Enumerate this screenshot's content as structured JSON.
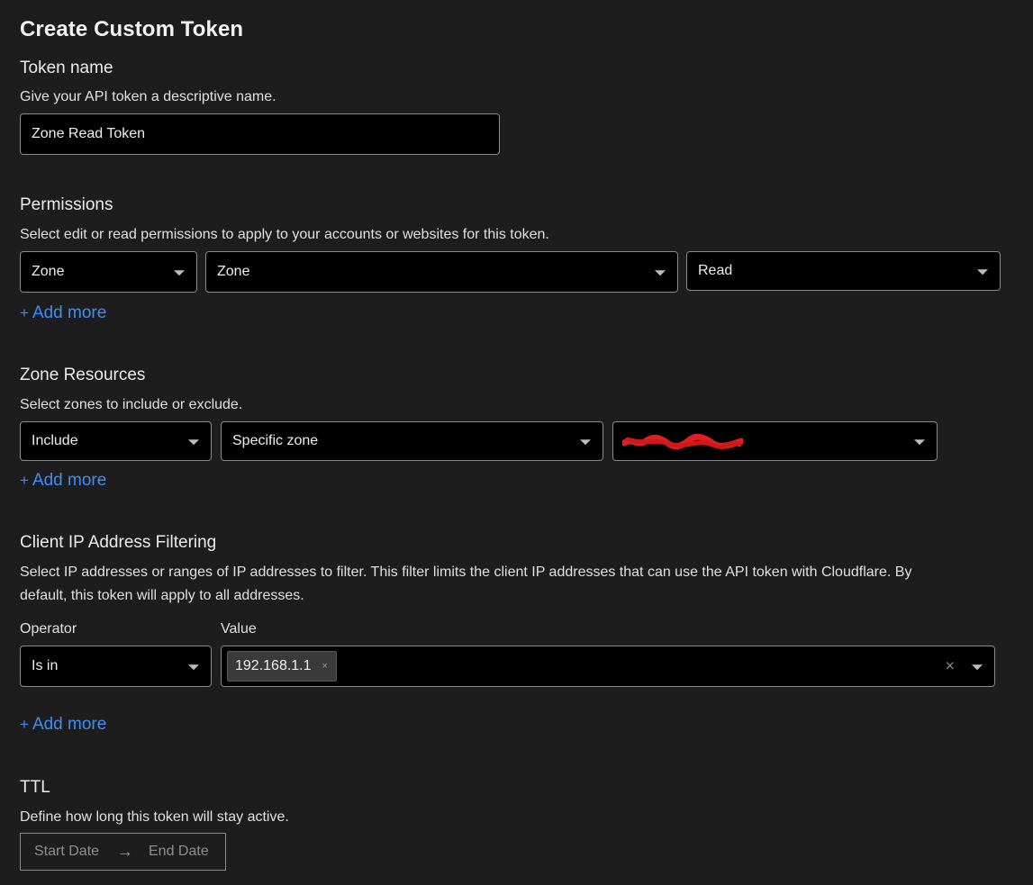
{
  "page": {
    "title": "Create Custom Token"
  },
  "token_name": {
    "heading": "Token name",
    "description": "Give your API token a descriptive name.",
    "value": "Zone Read Token"
  },
  "permissions": {
    "heading": "Permissions",
    "description": "Select edit or read permissions to apply to your accounts or websites for this token.",
    "selects": [
      "Zone",
      "Zone",
      "Read"
    ],
    "add_more": "Add more"
  },
  "zone_resources": {
    "heading": "Zone Resources",
    "description": "Select zones to include or exclude.",
    "selects": [
      "Include",
      "Specific zone"
    ],
    "add_more": "Add more"
  },
  "client_ip": {
    "heading": "Client IP Address Filtering",
    "description_line1": "Select IP addresses or ranges of IP addresses to filter. This filter limits the client IP addresses that can use the API token with Cloudflare. By",
    "description_line2": "default, this token will apply to all addresses.",
    "operator_label": "Operator",
    "value_label": "Value",
    "operator": "Is in",
    "chip": "192.168.1.1",
    "chip_remove": "×",
    "clear": "×",
    "add_more": "Add more"
  },
  "ttl": {
    "heading": "TTL",
    "description": "Define how long this token will stay active.",
    "start_placeholder": "Start Date",
    "arrow": "→",
    "end_placeholder": "End Date"
  },
  "colors": {
    "background": "#1d1d1d",
    "field": "#000000",
    "border": "#8a8a8a",
    "link": "#3d8ef7",
    "redaction": "#e02020"
  },
  "icons": {
    "plus": "+",
    "caret": "chevron-down-icon",
    "arrow": "arrow-right-icon"
  }
}
